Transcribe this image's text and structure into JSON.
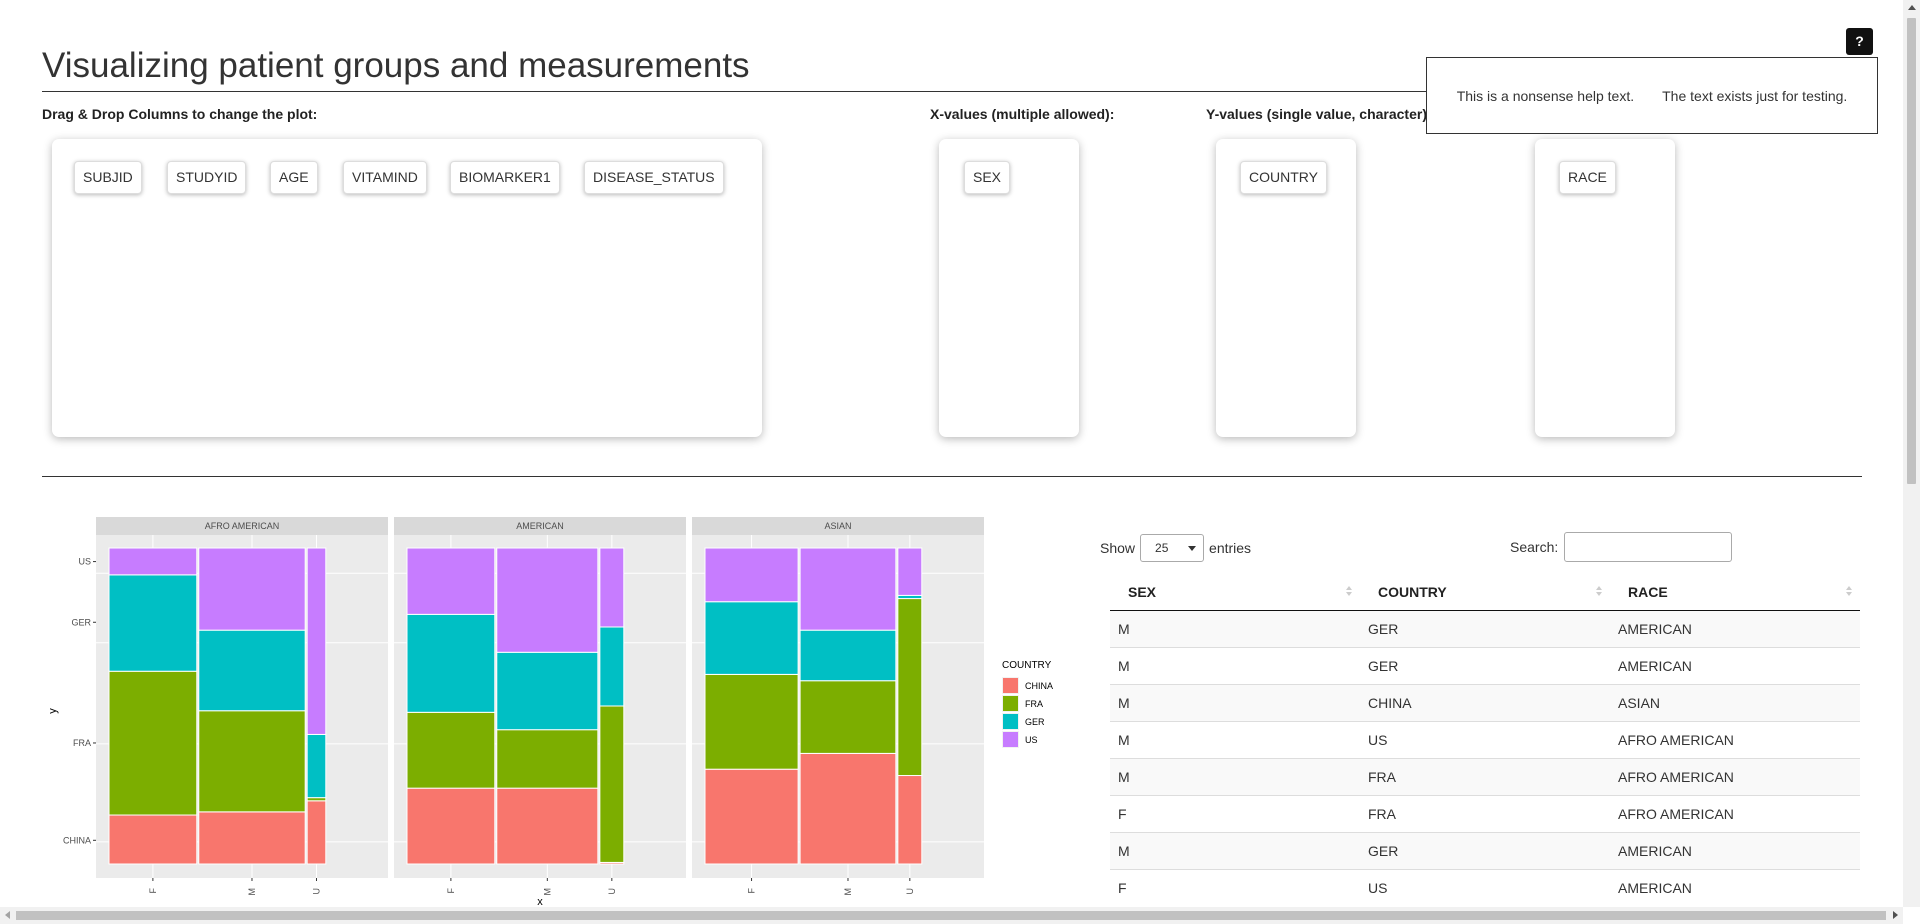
{
  "page": {
    "title": "Visualizing patient groups and measurements"
  },
  "help": {
    "button_label": "?",
    "text1": "This is a nonsense help text.",
    "text2": "The text exists just for testing."
  },
  "dragdrop": {
    "label": "Drag & Drop Columns to change the plot:",
    "x_label": "X-values (multiple allowed):",
    "y_label": "Y-values (single value, character)",
    "available": [
      "SUBJID",
      "STUDYID",
      "AGE",
      "VITAMIND",
      "BIOMARKER1",
      "DISEASE_STATUS"
    ],
    "x_values": [
      "SEX"
    ],
    "y_values": [
      "COUNTRY"
    ],
    "facet_values": [
      "RACE"
    ]
  },
  "chart_data": {
    "type": "mosaic",
    "facets": [
      "AFRO AMERICAN",
      "AMERICAN",
      "ASIAN"
    ],
    "x_categories": [
      "F",
      "M",
      "U"
    ],
    "y_categories": [
      "CHINA",
      "FRA",
      "GER",
      "US"
    ],
    "xlabel": "x",
    "ylabel": "y",
    "legend": {
      "title": "COUNTRY",
      "position": "right",
      "entries": [
        "CHINA",
        "FRA",
        "GER",
        "US"
      ]
    },
    "colors": {
      "CHINA": "#F8766D",
      "FRA": "#7CAE00",
      "GER": "#00BFC4",
      "US": "#C77CFF"
    },
    "panels": [
      {
        "facet": "AFRO AMERICAN",
        "x_widths": [
          0.33,
          0.4,
          0.07
        ],
        "stacks": [
          {
            "x": "F",
            "CHINA": 0.155,
            "FRA": 0.455,
            "GER": 0.305,
            "US": 0.085
          },
          {
            "x": "M",
            "CHINA": 0.165,
            "FRA": 0.32,
            "GER": 0.255,
            "US": 0.26
          },
          {
            "x": "U",
            "CHINA": 0.2,
            "FRA": 0.01,
            "GER": 0.2,
            "US": 0.59
          }
        ]
      },
      {
        "facet": "AMERICAN",
        "x_widths": [
          0.33,
          0.38,
          0.09
        ],
        "stacks": [
          {
            "x": "F",
            "CHINA": 0.24,
            "FRA": 0.24,
            "GER": 0.31,
            "US": 0.21
          },
          {
            "x": "M",
            "CHINA": 0.24,
            "FRA": 0.185,
            "GER": 0.245,
            "US": 0.33
          },
          {
            "x": "U",
            "CHINA": 0.005,
            "FRA": 0.495,
            "GER": 0.25,
            "US": 0.25
          }
        ]
      },
      {
        "facet": "ASIAN",
        "x_widths": [
          0.35,
          0.36,
          0.09
        ],
        "stacks": [
          {
            "x": "F",
            "CHINA": 0.3,
            "FRA": 0.3,
            "GER": 0.23,
            "US": 0.17
          },
          {
            "x": "M",
            "CHINA": 0.35,
            "FRA": 0.23,
            "GER": 0.16,
            "US": 0.26
          },
          {
            "x": "U",
            "CHINA": 0.28,
            "FRA": 0.56,
            "GER": 0.01,
            "US": 0.15
          }
        ]
      }
    ]
  },
  "table": {
    "show_label": "Show",
    "entries_value": "25",
    "entries_label": "entries",
    "search_label": "Search:",
    "columns": [
      "SEX",
      "COUNTRY",
      "RACE"
    ],
    "rows": [
      [
        "M",
        "GER",
        "AMERICAN"
      ],
      [
        "M",
        "GER",
        "AMERICAN"
      ],
      [
        "M",
        "CHINA",
        "ASIAN"
      ],
      [
        "M",
        "US",
        "AFRO AMERICAN"
      ],
      [
        "M",
        "FRA",
        "AFRO AMERICAN"
      ],
      [
        "F",
        "FRA",
        "AFRO AMERICAN"
      ],
      [
        "M",
        "GER",
        "AMERICAN"
      ],
      [
        "F",
        "US",
        "AMERICAN"
      ]
    ]
  }
}
